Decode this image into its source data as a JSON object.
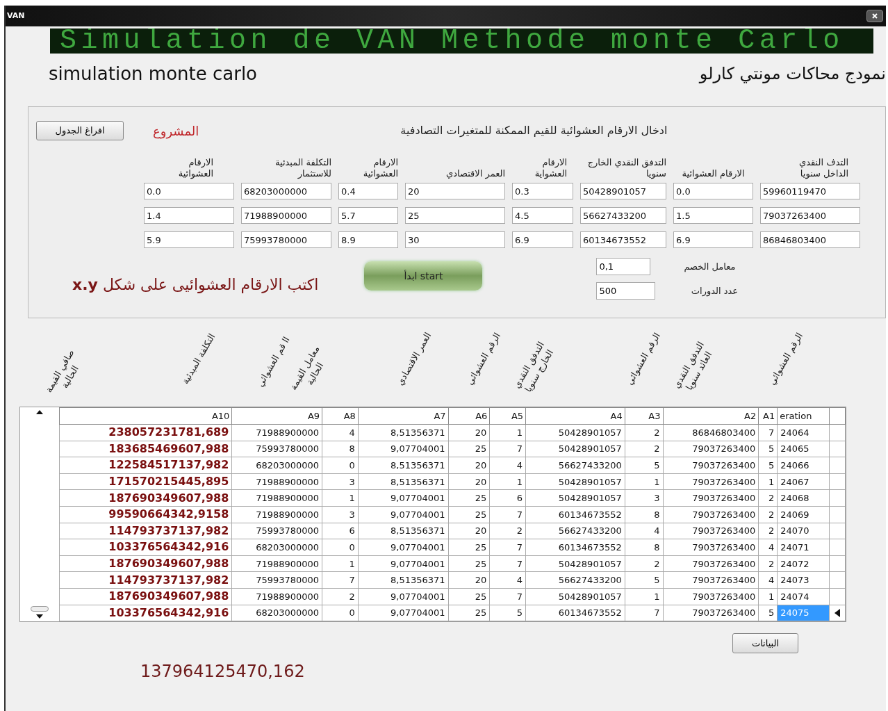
{
  "window": {
    "title": "VAN"
  },
  "banner": "Simulation de VAN Methode monte Carlo",
  "subtitle_left": "simulation monte carlo",
  "subtitle_right": "نمودج محاكات مونتي كارلو",
  "panel": {
    "clear_button": "افراغ الجدول",
    "project_label": "المشروع",
    "instruction": "ادخال الارقام العشوائية للقيم الممكنة للمتغيرات التصادفية",
    "columns": [
      {
        "header": "التدف النقدي الداخل سنويا",
        "values": [
          "59960119470",
          "79037263400",
          "86846803400"
        ]
      },
      {
        "header": "الارقام العشوائية",
        "values": [
          "0.0",
          "1.5",
          "6.9"
        ]
      },
      {
        "header": "التدفق النقدي الخارج سنويا",
        "values": [
          "50428901057",
          "56627433200",
          "60134673552"
        ]
      },
      {
        "header": "الارقام العشواية",
        "values": [
          "0.3",
          "4.5",
          "6.9"
        ]
      },
      {
        "header": "العمر الاقتصادي",
        "values": [
          "20",
          "25",
          "30"
        ]
      },
      {
        "header": "الارقام العشوائية",
        "values": [
          "0.4",
          "5.7",
          "8.9"
        ]
      },
      {
        "header": "التكلفة المبدئية للاستثمار",
        "values": [
          "68203000000",
          "71988900000",
          "75993780000"
        ]
      },
      {
        "header": "الارقام العشوائية",
        "values": [
          "0.0",
          "1.4",
          "5.9"
        ]
      }
    ],
    "hint": "اكتب الارقام العشوائيى على شكل **x.y**",
    "start_button": "ابدأ start",
    "settings": [
      {
        "label": "معامل الخصم",
        "value": "0,1"
      },
      {
        "label": "عدد الدورات",
        "value": "500"
      }
    ]
  },
  "results": {
    "rotated_headers": [
      "صافي القيمة الحالية",
      "التكلفة المبدئية",
      "اا قم العشوائي",
      "معامل القيمة الحالية",
      "العمر الاقتصادي",
      "الرقم العشوائي",
      "التدفق النقدي الخارج سنويا",
      "الرقم العشوائي",
      "التدفق النقدي العائد سنويا",
      "الرقم العشوائي"
    ],
    "columns": [
      "A10",
      "A9",
      "A8",
      "A7",
      "A6",
      "A5",
      "A4",
      "A3",
      "A2",
      "A1",
      "eration"
    ],
    "rows": [
      {
        "cells": [
          "238057231781,689",
          "71988900000",
          "4",
          "8,51356371",
          "20",
          "1",
          "50428901057",
          "2",
          "86846803400",
          "7",
          "24064"
        ],
        "selected": false
      },
      {
        "cells": [
          "183685469607,988",
          "75993780000",
          "8",
          "9,07704001",
          "25",
          "7",
          "50428901057",
          "2",
          "79037263400",
          "5",
          "24065"
        ],
        "selected": false
      },
      {
        "cells": [
          "122584517137,982",
          "68203000000",
          "0",
          "8,51356371",
          "20",
          "4",
          "56627433200",
          "5",
          "79037263400",
          "5",
          "24066"
        ],
        "selected": false
      },
      {
        "cells": [
          "171570215445,895",
          "71988900000",
          "3",
          "8,51356371",
          "20",
          "1",
          "50428901057",
          "1",
          "79037263400",
          "1",
          "24067"
        ],
        "selected": false
      },
      {
        "cells": [
          "187690349607,988",
          "71988900000",
          "1",
          "9,07704001",
          "25",
          "6",
          "50428901057",
          "3",
          "79037263400",
          "2",
          "24068"
        ],
        "selected": false
      },
      {
        "cells": [
          "99590664342,9158",
          "71988900000",
          "3",
          "9,07704001",
          "25",
          "7",
          "60134673552",
          "8",
          "79037263400",
          "2",
          "24069"
        ],
        "selected": false
      },
      {
        "cells": [
          "114793737137,982",
          "75993780000",
          "6",
          "8,51356371",
          "20",
          "2",
          "56627433200",
          "4",
          "79037263400",
          "2",
          "24070"
        ],
        "selected": false
      },
      {
        "cells": [
          "103376564342,916",
          "68203000000",
          "0",
          "9,07704001",
          "25",
          "7",
          "60134673552",
          "8",
          "79037263400",
          "4",
          "24071"
        ],
        "selected": false
      },
      {
        "cells": [
          "187690349607,988",
          "71988900000",
          "1",
          "9,07704001",
          "25",
          "7",
          "50428901057",
          "2",
          "79037263400",
          "2",
          "24072"
        ],
        "selected": false
      },
      {
        "cells": [
          "114793737137,982",
          "75993780000",
          "7",
          "8,51356371",
          "20",
          "4",
          "56627433200",
          "5",
          "79037263400",
          "4",
          "24073"
        ],
        "selected": false
      },
      {
        "cells": [
          "187690349607,988",
          "71988900000",
          "2",
          "9,07704001",
          "25",
          "7",
          "50428901057",
          "1",
          "79037263400",
          "1",
          "24074"
        ],
        "selected": false
      },
      {
        "cells": [
          "103376564342,916",
          "68203000000",
          "0",
          "9,07704001",
          "25",
          "5",
          "60134673552",
          "7",
          "79037263400",
          "5",
          "24075"
        ],
        "selected": true
      }
    ]
  },
  "data_button": "البيانات",
  "total": "137964125470,162"
}
